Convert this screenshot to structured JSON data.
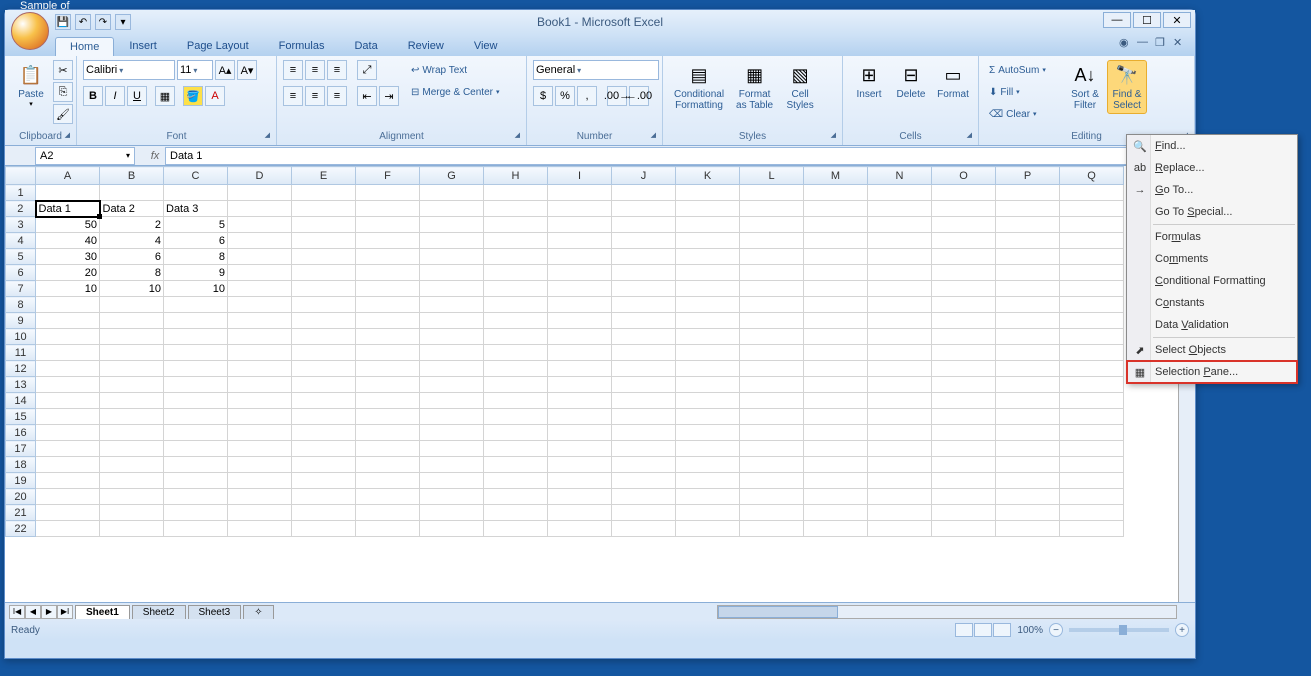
{
  "desktop": {
    "taskbar_hint": "Sample of"
  },
  "window": {
    "title": "Book1 - Microsoft Excel"
  },
  "qat": {
    "save": "💾",
    "undo": "↶",
    "redo": "↷"
  },
  "tabs": [
    "Home",
    "Insert",
    "Page Layout",
    "Formulas",
    "Data",
    "Review",
    "View"
  ],
  "active_tab": "Home",
  "ribbon": {
    "clipboard": {
      "label": "Clipboard",
      "paste": "Paste"
    },
    "font": {
      "label": "Font",
      "face": "Calibri",
      "size": "11",
      "bold": "B",
      "italic": "I",
      "underline": "U"
    },
    "alignment": {
      "label": "Alignment",
      "wrap": "Wrap Text",
      "merge": "Merge & Center"
    },
    "number": {
      "label": "Number",
      "format": "General"
    },
    "styles": {
      "label": "Styles",
      "conditional": "Conditional\nFormatting",
      "table": "Format\nas Table",
      "cell": "Cell\nStyles"
    },
    "cells": {
      "label": "Cells",
      "insert": "Insert",
      "delete": "Delete",
      "format": "Format"
    },
    "editing": {
      "label": "Editing",
      "autosum": "AutoSum",
      "fill": "Fill",
      "clear": "Clear",
      "sort": "Sort &\nFilter",
      "find": "Find &\nSelect"
    }
  },
  "namebox": "A2",
  "formula": "Data 1",
  "columns": [
    "A",
    "B",
    "C",
    "D",
    "E",
    "F",
    "G",
    "H",
    "I",
    "J",
    "K",
    "L",
    "M",
    "N",
    "O",
    "P",
    "Q"
  ],
  "rows": 22,
  "cells": {
    "A2": "Data 1",
    "B2": "Data 2",
    "C2": "Data 3",
    "A3": "50",
    "B3": "2",
    "C3": "5",
    "A4": "40",
    "B4": "4",
    "C4": "6",
    "A5": "30",
    "B5": "6",
    "C5": "8",
    "A6": "20",
    "B6": "8",
    "C6": "9",
    "A7": "10",
    "B7": "10",
    "C7": "10"
  },
  "active_cell": "A2",
  "text_cells": [
    "A2",
    "B2",
    "C2"
  ],
  "sheets": [
    "Sheet1",
    "Sheet2",
    "Sheet3"
  ],
  "active_sheet": "Sheet1",
  "status": {
    "ready": "Ready",
    "zoom": "100%"
  },
  "find_menu": {
    "items": [
      {
        "icon": "🔍",
        "label": "Find...",
        "u": 0
      },
      {
        "icon": "ab",
        "label": "Replace...",
        "u": 0
      },
      {
        "icon": "→",
        "label": "Go To...",
        "u": 0
      },
      {
        "icon": "",
        "label": "Go To Special...",
        "u": 6
      },
      {
        "sep": true
      },
      {
        "icon": "",
        "label": "Formulas",
        "u": 3
      },
      {
        "icon": "",
        "label": "Comments",
        "u": 2
      },
      {
        "icon": "",
        "label": "Conditional Formatting",
        "u": 0
      },
      {
        "icon": "",
        "label": "Constants",
        "u": 1
      },
      {
        "icon": "",
        "label": "Data Validation",
        "u": 5
      },
      {
        "sep": true
      },
      {
        "icon": "⬈",
        "label": "Select Objects",
        "u": 7
      },
      {
        "icon": "▦",
        "label": "Selection Pane...",
        "u": 10,
        "highlight": true
      }
    ]
  }
}
